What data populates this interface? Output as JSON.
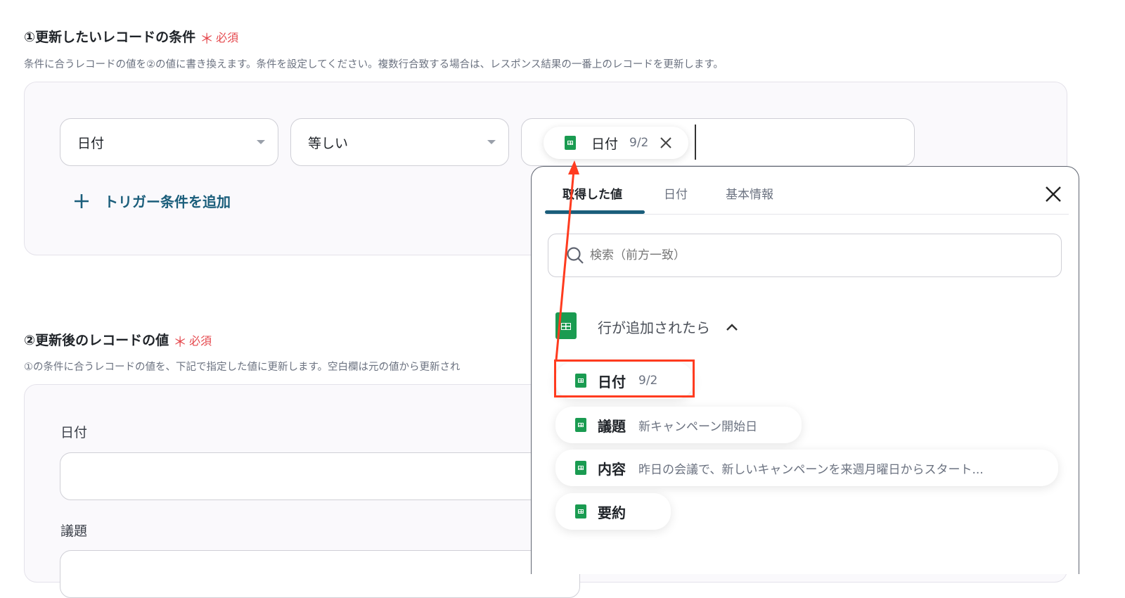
{
  "section1": {
    "title": "①更新したいレコードの条件",
    "required_star": "＊",
    "required_label": "必須",
    "description": "条件に合うレコードの値を②の値に書き換えます。条件を設定してください。複数行合致する場合は、レスポンス結果の一番上のレコードを更新します。",
    "condition": {
      "field_select": "日付",
      "operator_select": "等しい",
      "value_chip": {
        "name": "日付",
        "value": "9/2"
      }
    },
    "add_condition_label": "トリガー条件を追加"
  },
  "section2": {
    "title": "②更新後のレコードの値",
    "required_star": "＊",
    "required_label": "必須",
    "description": "①の条件に合うレコードの値を、下記で指定した値に更新します。空白欄は元の値から更新され",
    "fields": [
      {
        "label": "日付",
        "value": ""
      },
      {
        "label": "議題",
        "value": ""
      }
    ]
  },
  "popover": {
    "tabs": [
      "取得した値",
      "日付",
      "基本情報"
    ],
    "active_tab": 0,
    "search_placeholder": "検索（前方一致）",
    "group": {
      "title": "行が追加されたら",
      "expanded": true
    },
    "items": [
      {
        "name": "日付",
        "value": "9/2",
        "highlighted": true
      },
      {
        "name": "議題",
        "value": "新キャンペーン開始日",
        "highlighted": false
      },
      {
        "name": "内容",
        "value": "昨日の会議で、新しいキャンペーンを来週月曜日からスタート...",
        "highlighted": false
      },
      {
        "name": "要約",
        "value": "",
        "highlighted": false
      }
    ]
  },
  "colors": {
    "accent_tab_underline": "#1b5e7b",
    "add_link": "#1b5e7b",
    "required": "#e5484d",
    "sheets_green": "#1a9b51",
    "annotation_red": "#ff3b1f"
  },
  "icons": [
    "dropdown-caret-icon",
    "sheets-icon",
    "close-icon",
    "plus-icon",
    "search-icon",
    "chevron-up-icon"
  ]
}
